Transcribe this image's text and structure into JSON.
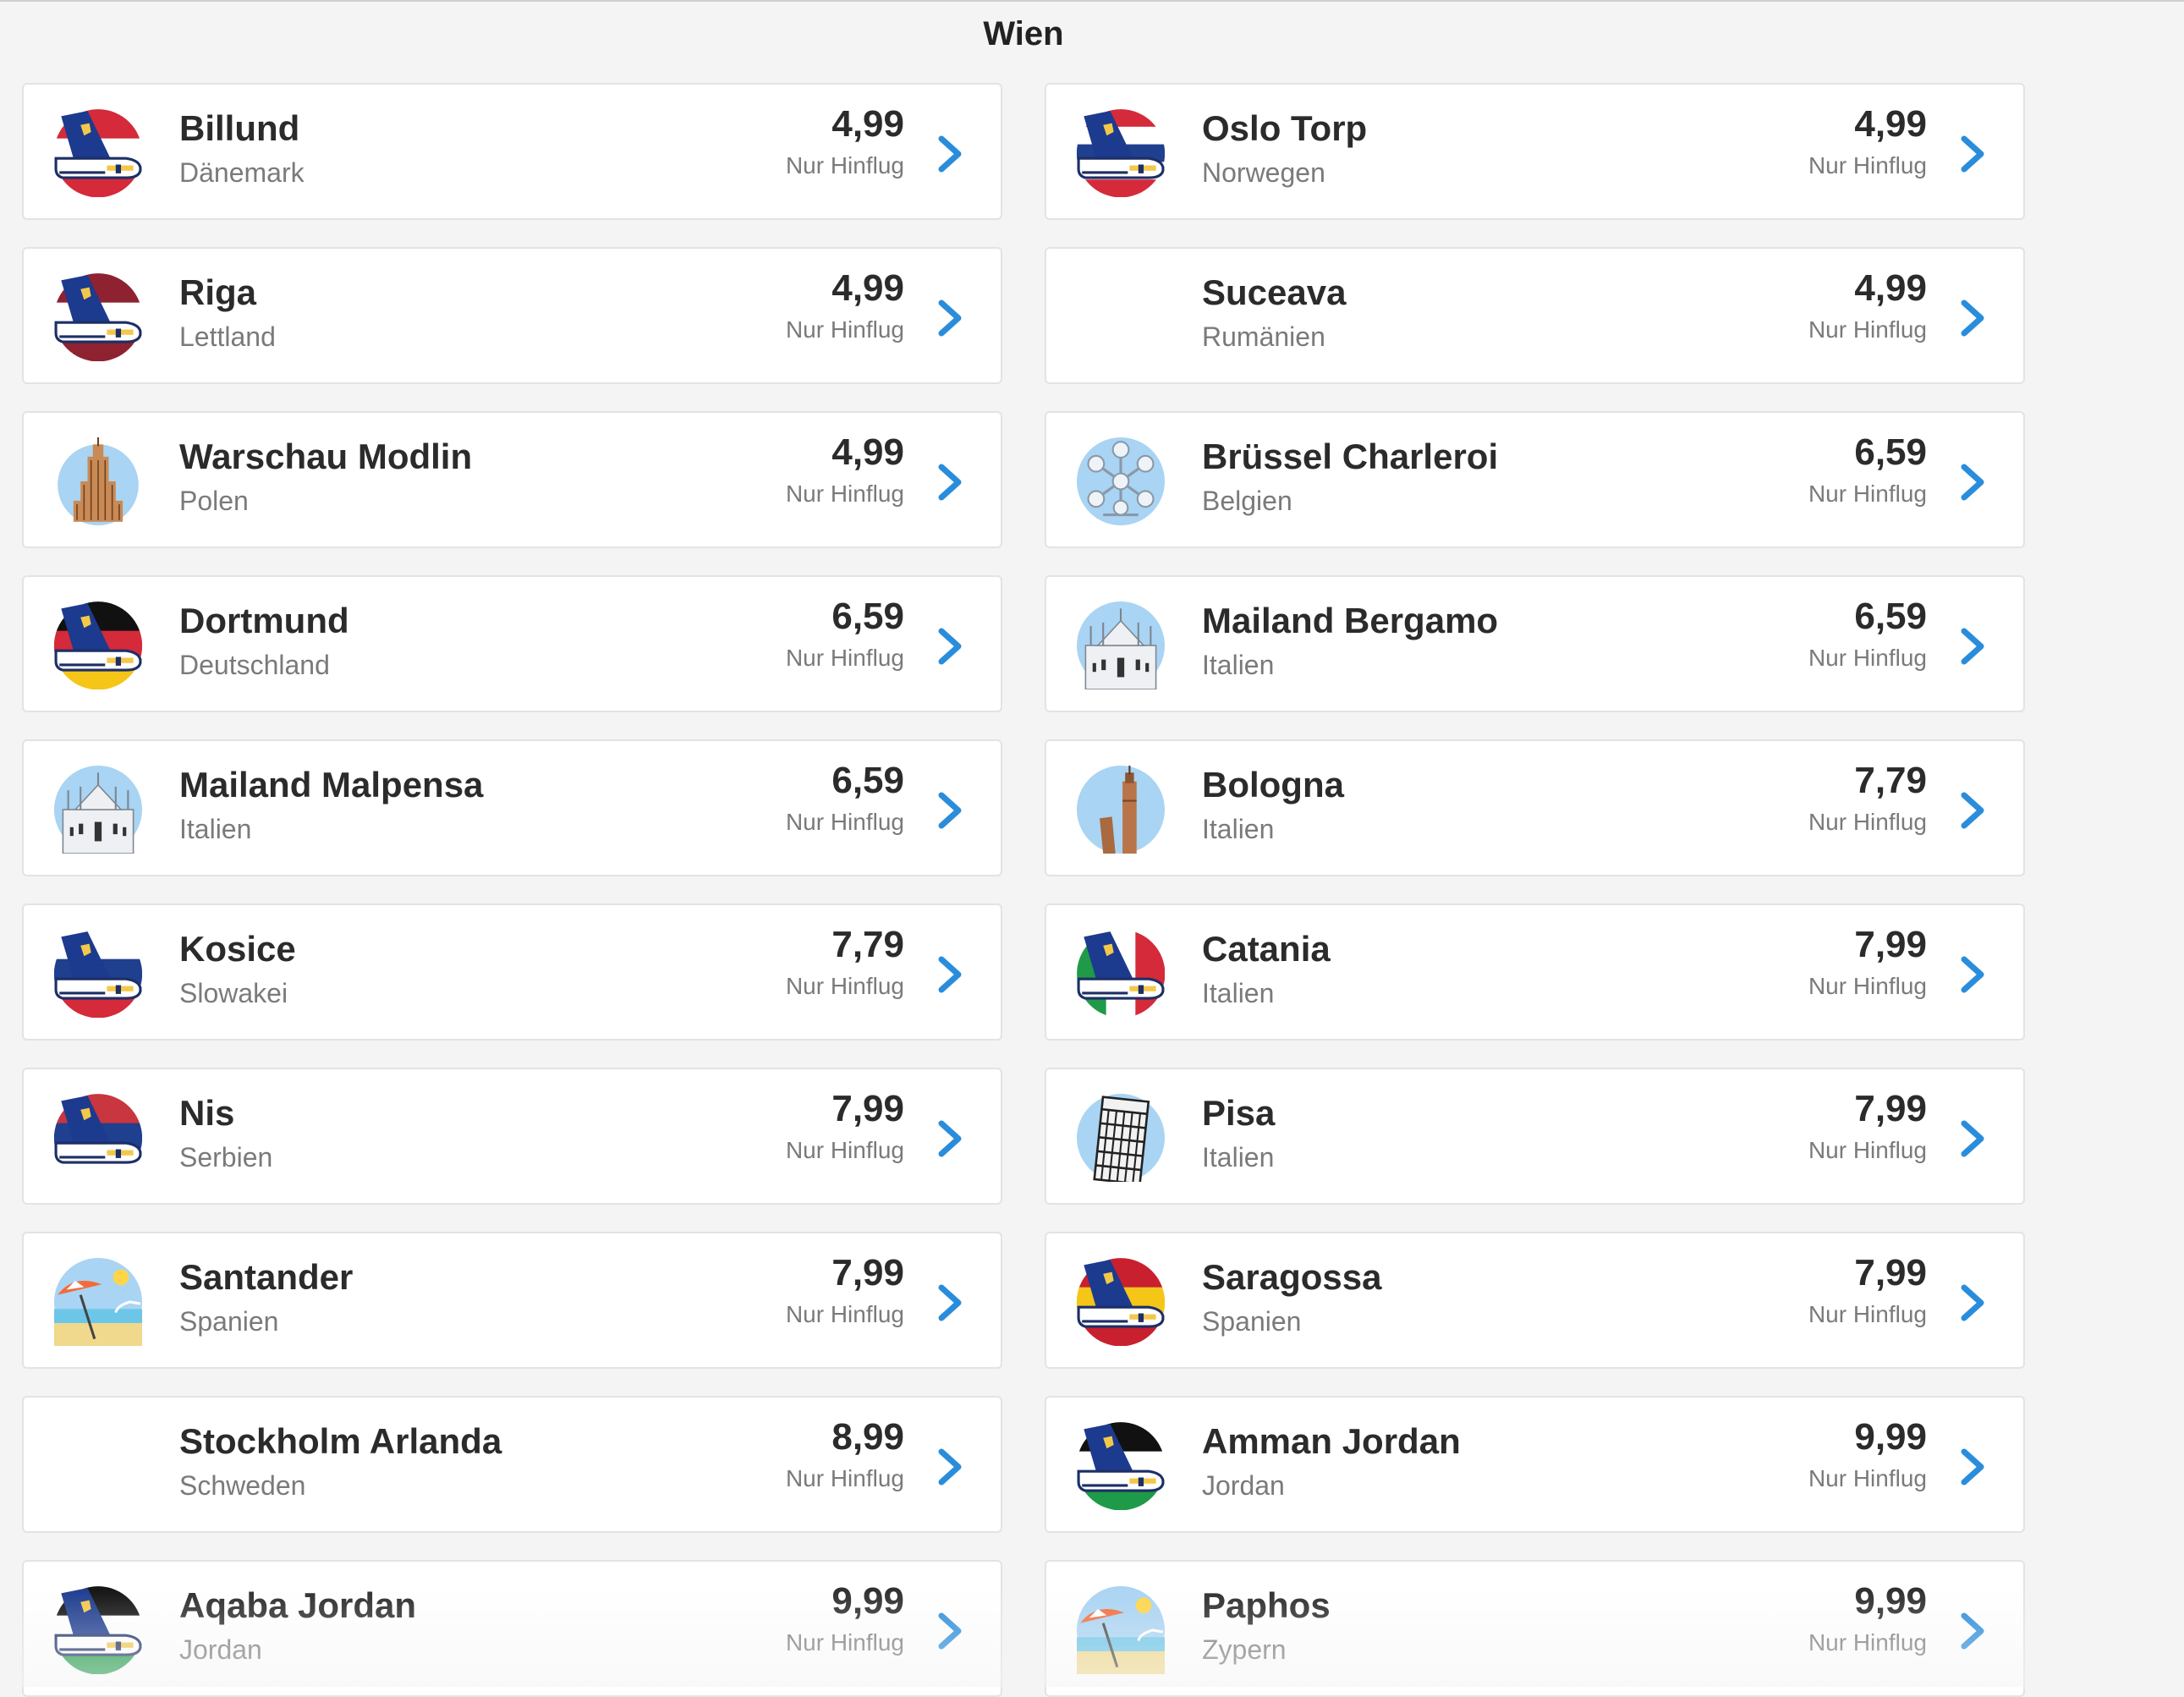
{
  "header": {
    "title": "Wien"
  },
  "common": {
    "note": "Nur Hinflug"
  },
  "colors": {
    "accent": "#2a8ddb",
    "plane_tail": "#1c3a8e",
    "plane_logo": "#f3c84a"
  },
  "destinations": [
    {
      "city": "Billund",
      "country": "Dänemark",
      "price": "4,99",
      "icon": "plane-denmark-flag-icon",
      "art": "plane",
      "flag": [
        "#d42a3a",
        "#ffffff",
        "#d42a3a"
      ]
    },
    {
      "city": "Oslo Torp",
      "country": "Norwegen",
      "price": "4,99",
      "icon": "plane-norway-flag-icon",
      "art": "plane",
      "flag": [
        "#d42a3a",
        "#ffffff",
        "#1f3f8f",
        "#ffffff",
        "#d42a3a"
      ]
    },
    {
      "city": "Riga",
      "country": "Lettland",
      "price": "4,99",
      "icon": "plane-latvia-flag-icon",
      "art": "plane",
      "flag": [
        "#8e2231",
        "#ffffff",
        "#8e2231"
      ]
    },
    {
      "city": "Suceava",
      "country": "Rumänien",
      "price": "4,99",
      "icon": "empty-thumbnail",
      "art": "none",
      "flag": []
    },
    {
      "city": "Warschau Modlin",
      "country": "Polen",
      "price": "4,99",
      "icon": "palace-of-culture-icon",
      "art": "tower",
      "flag": []
    },
    {
      "city": "Brüssel Charleroi",
      "country": "Belgien",
      "price": "6,59",
      "icon": "atomium-icon",
      "art": "atomium",
      "flag": []
    },
    {
      "city": "Dortmund",
      "country": "Deutschland",
      "price": "6,59",
      "icon": "plane-germany-flag-icon",
      "art": "plane",
      "flag": [
        "#111111",
        "#d42a3a",
        "#f5c518"
      ]
    },
    {
      "city": "Mailand Bergamo",
      "country": "Italien",
      "price": "6,59",
      "icon": "milan-cathedral-icon",
      "art": "cathedral",
      "flag": []
    },
    {
      "city": "Mailand Malpensa",
      "country": "Italien",
      "price": "6,59",
      "icon": "milan-cathedral-icon",
      "art": "cathedral",
      "flag": []
    },
    {
      "city": "Bologna",
      "country": "Italien",
      "price": "7,79",
      "icon": "bologna-towers-icon",
      "art": "bologna",
      "flag": []
    },
    {
      "city": "Kosice",
      "country": "Slowakei",
      "price": "7,79",
      "icon": "plane-slovakia-flag-icon",
      "art": "plane",
      "flag": [
        "#ffffff",
        "#1f3f8f",
        "#d42a3a"
      ]
    },
    {
      "city": "Catania",
      "country": "Italien",
      "price": "7,99",
      "icon": "plane-italy-flag-icon",
      "art": "plane-vertical",
      "flag": [
        "#1f9a48",
        "#ffffff",
        "#d42a3a"
      ]
    },
    {
      "city": "Nis",
      "country": "Serbien",
      "price": "7,99",
      "icon": "plane-serbia-flag-icon",
      "art": "plane",
      "flag": [
        "#c8363f",
        "#1f3f8f",
        "#ffffff"
      ]
    },
    {
      "city": "Pisa",
      "country": "Italien",
      "price": "7,99",
      "icon": "leaning-tower-icon",
      "art": "pisa",
      "flag": []
    },
    {
      "city": "Santander",
      "country": "Spanien",
      "price": "7,99",
      "icon": "beach-umbrella-icon",
      "art": "beach",
      "flag": []
    },
    {
      "city": "Saragossa",
      "country": "Spanien",
      "price": "7,99",
      "icon": "plane-spain-flag-icon",
      "art": "plane",
      "flag": [
        "#c8202f",
        "#f5c518",
        "#c8202f"
      ]
    },
    {
      "city": "Stockholm Arlanda",
      "country": "Schweden",
      "price": "8,99",
      "icon": "empty-thumbnail",
      "art": "none",
      "flag": []
    },
    {
      "city": "Amman Jordan",
      "country": "Jordan",
      "price": "9,99",
      "icon": "plane-jordan-flag-icon",
      "art": "plane",
      "flag": [
        "#111111",
        "#ffffff",
        "#1f9a48"
      ]
    },
    {
      "city": "Aqaba Jordan",
      "country": "Jordan",
      "price": "9,99",
      "icon": "plane-jordan-flag-icon",
      "art": "plane",
      "flag": [
        "#111111",
        "#ffffff",
        "#1f9a48"
      ]
    },
    {
      "city": "Paphos",
      "country": "Zypern",
      "price": "9,99",
      "icon": "beach-umbrella-icon",
      "art": "beach",
      "flag": []
    }
  ]
}
